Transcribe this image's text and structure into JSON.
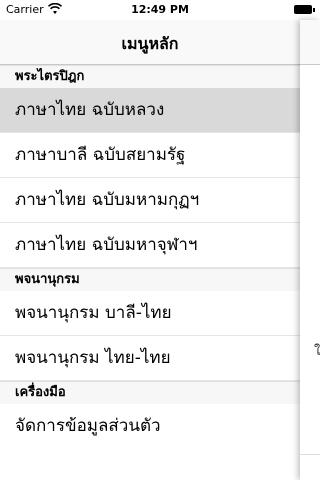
{
  "status_bar": {
    "carrier": "Carrier",
    "time": "12:49 PM",
    "icons": [
      "wifi-icon",
      "battery-icon"
    ]
  },
  "nav": {
    "title": "เมนูหลัก"
  },
  "sections": [
    {
      "header": "พระไตรปิฎก",
      "items": [
        {
          "label": "ภาษาไทย ฉบับหลวง",
          "selected": true
        },
        {
          "label": "ภาษาบาลี ฉบับสยามรัฐ",
          "selected": false
        },
        {
          "label": "ภาษาไทย ฉบับมหามกุฏฯ",
          "selected": false
        },
        {
          "label": "ภาษาไทย ฉบับมหาจุฬาฯ",
          "selected": false
        }
      ]
    },
    {
      "header": "พจนานุกรม",
      "items": [
        {
          "label": "พจนานุกรม บาลี-ไทย",
          "selected": false
        },
        {
          "label": "พจนานุกรม ไทย-ไทย",
          "selected": false
        }
      ]
    },
    {
      "header": "เครื่องมือ",
      "items": [
        {
          "label": "จัดการข้อมูลส่วนตัว",
          "selected": false
        }
      ]
    }
  ],
  "side_panel": {
    "peek_text": "ใ"
  },
  "colors": {
    "selected_row": "#d9d9d9",
    "section_bg": "#f7f7f7",
    "nav_bg": "#f9f9f9"
  }
}
